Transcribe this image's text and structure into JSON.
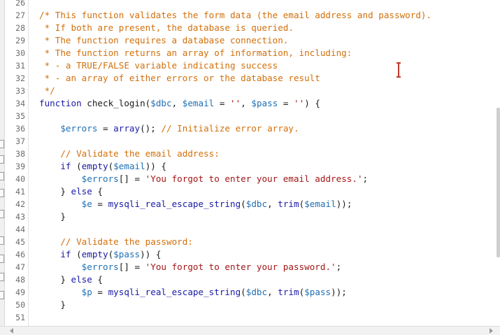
{
  "editor": {
    "lines": [
      {
        "num": "26",
        "tokens": []
      },
      {
        "num": "27",
        "tokens": [
          {
            "t": "comment",
            "v": "/* This function validates the form data (the email address and password)."
          }
        ]
      },
      {
        "num": "28",
        "tokens": [
          {
            "t": "comment",
            "v": " * If both are present, the database is queried."
          }
        ]
      },
      {
        "num": "29",
        "tokens": [
          {
            "t": "comment",
            "v": " * The function requires a database connection."
          }
        ]
      },
      {
        "num": "30",
        "tokens": [
          {
            "t": "comment",
            "v": " * The function returns an array of information, including:"
          }
        ]
      },
      {
        "num": "31",
        "tokens": [
          {
            "t": "comment",
            "v": " * - a TRUE/FALSE variable indicating success"
          }
        ]
      },
      {
        "num": "32",
        "tokens": [
          {
            "t": "comment",
            "v": " * - an array of either errors or the database result"
          }
        ]
      },
      {
        "num": "33",
        "tokens": [
          {
            "t": "comment",
            "v": " */"
          }
        ]
      },
      {
        "num": "34",
        "tokens": [
          {
            "t": "keyword",
            "v": "function"
          },
          {
            "t": "plain",
            "v": " check_login("
          },
          {
            "t": "variable",
            "v": "$dbc"
          },
          {
            "t": "plain",
            "v": ", "
          },
          {
            "t": "variable",
            "v": "$email"
          },
          {
            "t": "plain",
            "v": " = "
          },
          {
            "t": "string",
            "v": "''"
          },
          {
            "t": "plain",
            "v": ", "
          },
          {
            "t": "variable",
            "v": "$pass"
          },
          {
            "t": "plain",
            "v": " = "
          },
          {
            "t": "string",
            "v": "''"
          },
          {
            "t": "plain",
            "v": ") {"
          }
        ]
      },
      {
        "num": "35",
        "tokens": []
      },
      {
        "num": "36",
        "tokens": [
          {
            "t": "plain",
            "v": "    "
          },
          {
            "t": "variable",
            "v": "$errors"
          },
          {
            "t": "plain",
            "v": " = "
          },
          {
            "t": "function",
            "v": "array"
          },
          {
            "t": "plain",
            "v": "(); "
          },
          {
            "t": "comment",
            "v": "// Initialize error array."
          }
        ]
      },
      {
        "num": "37",
        "tokens": []
      },
      {
        "num": "38",
        "tokens": [
          {
            "t": "plain",
            "v": "    "
          },
          {
            "t": "comment",
            "v": "// Validate the email address:"
          }
        ]
      },
      {
        "num": "39",
        "tokens": [
          {
            "t": "plain",
            "v": "    "
          },
          {
            "t": "keyword",
            "v": "if"
          },
          {
            "t": "plain",
            "v": " ("
          },
          {
            "t": "function",
            "v": "empty"
          },
          {
            "t": "plain",
            "v": "("
          },
          {
            "t": "variable",
            "v": "$email"
          },
          {
            "t": "plain",
            "v": ")) {"
          }
        ]
      },
      {
        "num": "40",
        "tokens": [
          {
            "t": "plain",
            "v": "        "
          },
          {
            "t": "variable",
            "v": "$errors"
          },
          {
            "t": "plain",
            "v": "[] = "
          },
          {
            "t": "string",
            "v": "'You forgot to enter your email address.'"
          },
          {
            "t": "plain",
            "v": ";"
          }
        ]
      },
      {
        "num": "41",
        "tokens": [
          {
            "t": "plain",
            "v": "    } "
          },
          {
            "t": "keyword",
            "v": "else"
          },
          {
            "t": "plain",
            "v": " {"
          }
        ]
      },
      {
        "num": "42",
        "tokens": [
          {
            "t": "plain",
            "v": "        "
          },
          {
            "t": "variable",
            "v": "$e"
          },
          {
            "t": "plain",
            "v": " = "
          },
          {
            "t": "function",
            "v": "mysqli_real_escape_string"
          },
          {
            "t": "plain",
            "v": "("
          },
          {
            "t": "variable",
            "v": "$dbc"
          },
          {
            "t": "plain",
            "v": ", "
          },
          {
            "t": "function",
            "v": "trim"
          },
          {
            "t": "plain",
            "v": "("
          },
          {
            "t": "variable",
            "v": "$email"
          },
          {
            "t": "plain",
            "v": "));"
          }
        ]
      },
      {
        "num": "43",
        "tokens": [
          {
            "t": "plain",
            "v": "    }"
          }
        ]
      },
      {
        "num": "44",
        "tokens": []
      },
      {
        "num": "45",
        "tokens": [
          {
            "t": "plain",
            "v": "    "
          },
          {
            "t": "comment",
            "v": "// Validate the password:"
          }
        ]
      },
      {
        "num": "46",
        "tokens": [
          {
            "t": "plain",
            "v": "    "
          },
          {
            "t": "keyword",
            "v": "if"
          },
          {
            "t": "plain",
            "v": " ("
          },
          {
            "t": "function",
            "v": "empty"
          },
          {
            "t": "plain",
            "v": "("
          },
          {
            "t": "variable",
            "v": "$pass"
          },
          {
            "t": "plain",
            "v": ")) {"
          }
        ]
      },
      {
        "num": "47",
        "tokens": [
          {
            "t": "plain",
            "v": "        "
          },
          {
            "t": "variable",
            "v": "$errors"
          },
          {
            "t": "plain",
            "v": "[] = "
          },
          {
            "t": "string",
            "v": "'You forgot to enter your password.'"
          },
          {
            "t": "plain",
            "v": ";"
          }
        ]
      },
      {
        "num": "48",
        "tokens": [
          {
            "t": "plain",
            "v": "    } "
          },
          {
            "t": "keyword",
            "v": "else"
          },
          {
            "t": "plain",
            "v": " {"
          }
        ]
      },
      {
        "num": "49",
        "tokens": [
          {
            "t": "plain",
            "v": "        "
          },
          {
            "t": "variable",
            "v": "$p"
          },
          {
            "t": "plain",
            "v": " = "
          },
          {
            "t": "function",
            "v": "mysqli_real_escape_string"
          },
          {
            "t": "plain",
            "v": "("
          },
          {
            "t": "variable",
            "v": "$dbc"
          },
          {
            "t": "plain",
            "v": ", "
          },
          {
            "t": "function",
            "v": "trim"
          },
          {
            "t": "plain",
            "v": "("
          },
          {
            "t": "variable",
            "v": "$pass"
          },
          {
            "t": "plain",
            "v": "));"
          }
        ]
      },
      {
        "num": "50",
        "tokens": [
          {
            "t": "plain",
            "v": "    }"
          }
        ]
      },
      {
        "num": "51",
        "tokens": []
      }
    ]
  },
  "icons": {
    "cursor": "text-cursor-icon",
    "scroll_left": "scroll-left-arrow-icon",
    "scroll_right": "scroll-right-arrow-icon"
  },
  "colors": {
    "comment": "#d26f0a",
    "keyword": "#1a1aa6",
    "variable": "#1f6fb5",
    "string": "#a31515",
    "cursor": "#c0392b"
  }
}
